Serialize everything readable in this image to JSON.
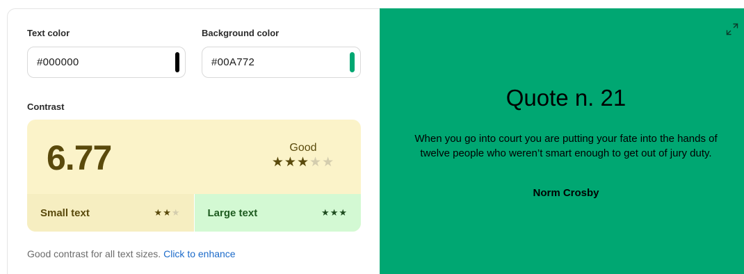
{
  "text_color": {
    "label": "Text color",
    "value": "#000000",
    "swatch": "#000000"
  },
  "background_color": {
    "label": "Background color",
    "value": "#00A772",
    "swatch": "#00A772"
  },
  "contrast": {
    "label": "Contrast",
    "ratio": "6.77",
    "rating": "Good",
    "rating_stars": 3,
    "rating_stars_max": 5,
    "small_text": {
      "label": "Small text",
      "stars": 2,
      "stars_max": 3
    },
    "large_text": {
      "label": "Large text",
      "stars": 3,
      "stars_max": 3
    }
  },
  "hint": {
    "text": "Good contrast for all text sizes.",
    "link": "Click to enhance"
  },
  "preview": {
    "title": "Quote n. 21",
    "quote": "When you go into court you are putting your fate into the hands of twelve people who weren’t smart enough to get out of jury duty.",
    "author": "Norm Crosby",
    "expand_icon": "expand-icon"
  },
  "colors": {
    "preview_bg": "#00A772",
    "card_bg": "#FBF3C9",
    "large_bg": "#D3F9D3",
    "link": "#1B6AC9"
  }
}
